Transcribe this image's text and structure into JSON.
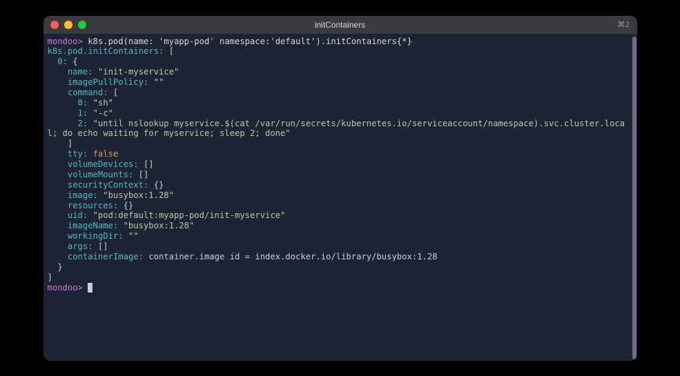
{
  "window": {
    "title": "initContainers",
    "tab_indicator": "⌘2"
  },
  "prompt": "mondoo>",
  "command": "k8s.pod(name: 'myapp-pod' namespace:'default').initContainers{*}",
  "output_header": "k8s.pod.initContainers:",
  "index_label": "0:",
  "fields": {
    "name": {
      "key": "name:",
      "value": "\"init-myservice\""
    },
    "imagePullPolicy": {
      "key": "imagePullPolicy:",
      "value": "\"\""
    },
    "command": {
      "key": "command:",
      "items": {
        "i0": {
          "idx": "0:",
          "val": "\"sh\""
        },
        "i1": {
          "idx": "1:",
          "val": "\"-c\""
        },
        "i2": {
          "idx": "2:",
          "val": "\"until nslookup myservice.$(cat /var/run/secrets/kubernetes.io/serviceaccount/namespace).svc.cluster.local; do echo waiting for myservice; sleep 2; done\""
        }
      }
    },
    "tty": {
      "key": "tty:",
      "value": "false"
    },
    "volumeDevices": {
      "key": "volumeDevices:",
      "value": "[]"
    },
    "volumeMounts": {
      "key": "volumeMounts:",
      "value": "[]"
    },
    "securityContext": {
      "key": "securityContext:",
      "value": "{}"
    },
    "image": {
      "key": "image:",
      "value": "\"busybox:1.28\""
    },
    "resources": {
      "key": "resources:",
      "value": "{}"
    },
    "uid": {
      "key": "uid:",
      "value": "\"pod:default:myapp-pod/init-myservice\""
    },
    "imageName": {
      "key": "imageName:",
      "value": "\"busybox:1.28\""
    },
    "workingDir": {
      "key": "workingDir:",
      "value": "\"\""
    },
    "args": {
      "key": "args:",
      "value": "[]"
    },
    "containerImage": {
      "key": "containerImage:",
      "value": "container.image id = index.docker.io/library/busybox:1.28"
    }
  },
  "brackets": {
    "open_arr": "[",
    "close_arr": "]",
    "open_obj": "{",
    "close_obj": "}"
  }
}
